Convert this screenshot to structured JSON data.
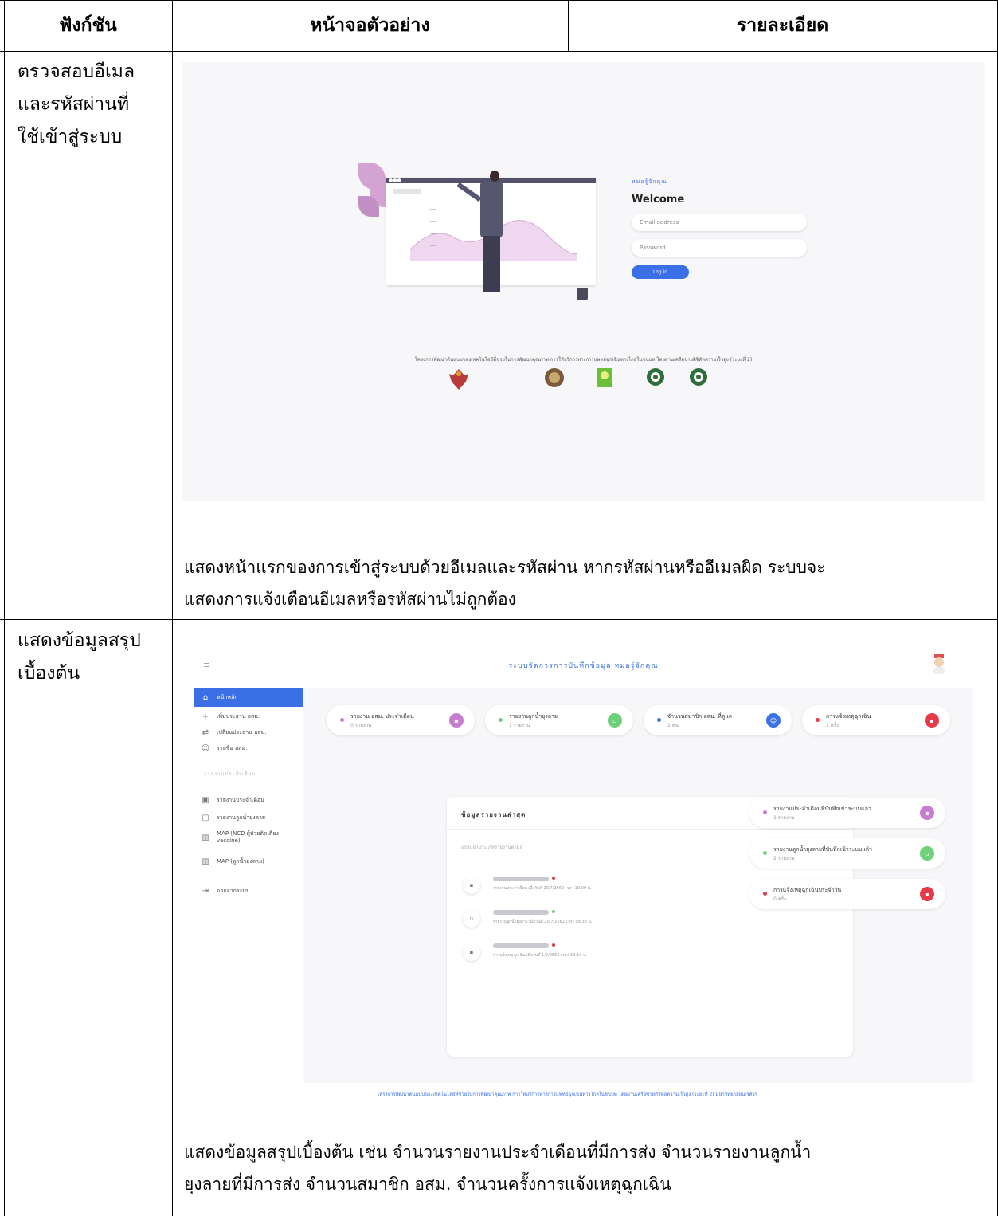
{
  "table": {
    "headers": [
      "ฟังก์ชัน",
      "หน้าจอตัวอย่าง",
      "รายละเอียด"
    ],
    "rows": [
      {
        "function_lines": [
          "ตรวจสอบอีเมล",
          "และรหัสผ่านที่",
          "ใช้เข้าสู่ระบบ"
        ],
        "description_lines": [
          "แสดงหน้าแรกของการเข้าสู่ระบบด้วยอีเมลและรหัสผ่าน หากรหัสผ่านหรืออีเมลผิด ระบบจะ",
          "แสดงการแจ้งเตือนอีเมลหรือรหัสผ่านไม่ถูกต้อง"
        ]
      },
      {
        "function_lines": [
          "แสดงข้อมูลสรุป",
          "เบื้องต้น"
        ],
        "description_lines": [
          "แสดงข้อมูลสรุปเบื้องต้น เช่น จำนวนรายงานประจำเดือนที่มีการส่ง จำนวนรายงานลูกน้ำ",
          "ยุงลายที่มีการส่ง จำนวนสมาชิก อสม. จำนวนครั้งการแจ้งเหตุฉุกเฉิน"
        ]
      }
    ]
  },
  "login_screen": {
    "brand": "หมอรู้จักคุณ",
    "welcome": "Welcome",
    "email_placeholder": "Email address",
    "password_placeholder": "Password",
    "login_button": "Log in",
    "project_text": "โครงการพัฒนาต้นแบบของเทคโนโลยีที่ช่วยในการพัฒนาคุณภาพ การให้บริการทางการแพทย์ฉุกเฉินทางไกลในชนบท โดยผ่านเครือข่ายดิจิทัลความเร็วสูง (ระยะที่ 2)"
  },
  "dashboard": {
    "title": "ระบบจัดการการบันทึกข้อมูล หมอรู้จักคุณ",
    "sidebar": {
      "items": [
        {
          "label": "หน้าหลัก",
          "icon": "home-icon"
        },
        {
          "label": "เพิ่มประธาน อสม.",
          "icon": "add-user-icon"
        },
        {
          "label": "เปลี่ยนประธาน อสม.",
          "icon": "swap-icon"
        },
        {
          "label": "รายชื่อ อสม.",
          "icon": "users-icon"
        }
      ],
      "section_label": "รายงานประจำเดือน",
      "report_items": [
        {
          "label": "รายงานประจำเดือน",
          "icon": "clipboard-icon"
        },
        {
          "label": "รายงานลูกน้ำยุงลาย",
          "icon": "clipboard-icon"
        },
        {
          "label": "MAP (NCD ผู้ป่วยติดเตียง vaccine)",
          "icon": "map-icon"
        },
        {
          "label": "MAP (ลูกน้ำยุงลาย)",
          "icon": "map-icon"
        },
        {
          "label": "ออกจากระบบ",
          "icon": "logout-icon"
        }
      ]
    },
    "top_cards": [
      {
        "title": "รายงาน อสม. ประจำเดือน",
        "sub": "0 รายงาน",
        "color": "#c77dcf"
      },
      {
        "title": "รายงานลูกน้ำยุงลาย",
        "sub": "1 รายงาน",
        "color": "#6fd07a"
      },
      {
        "title": "จำนวนสมาชิก อสม. ที่ดูแล",
        "sub": "1 คน",
        "color": "#3a6fe5"
      },
      {
        "title": "การแจ้งเหตุฉุกเฉิน",
        "sub": "1 ครั้ง",
        "color": "#e53a4a"
      }
    ],
    "panel": {
      "title": "ข้อมูลรายงานล่าสุด",
      "subtitle": "แบ่งแยกประเภทรายงานตามสี",
      "entries": [
        {
          "text": "รายงานประจำเดือน เมื่อวันที่ 20/7/2562 เวลา 10:09 น.",
          "color": "#e53a4a"
        },
        {
          "text": "รายงานลูกน้ำยุงลาย เมื่อวันที่ 20/7/2562 เวลา 09:38 น.",
          "color": "#6fd07a"
        },
        {
          "text": "การแจ้งเหตุฉุกเฉิน เมื่อวันที่ 1/9/2562 เวลา 10:10 น.",
          "color": "#e53a4a"
        }
      ]
    },
    "side_cards": [
      {
        "title": "รายงานประจำเดือนที่บันทึกเข้าระบบแล้ว",
        "sub": "1 รายงาน",
        "color": "#c77dcf"
      },
      {
        "title": "รายงานลูกน้ำยุงลายที่บันทึกเข้าระบบแล้ว",
        "sub": "2 รายงาน",
        "color": "#6fd07a"
      },
      {
        "title": "การแจ้งเหตุฉุกเฉินประจำวัน",
        "sub": "0 ครั้ง",
        "color": "#e53a4a"
      }
    ],
    "footer": "โครงการพัฒนาต้นแบบของเทคโนโลยีที่ช่วยในการพัฒนาคุณภาพ การให้บริการทางการแพทย์ฉุกเฉินทางไกลในชนบท โดยผ่านเครือข่ายดิจิทัลความเร็วสูง (ระยะที่ 2) มหาวิทยาลัยนเรศวร"
  }
}
